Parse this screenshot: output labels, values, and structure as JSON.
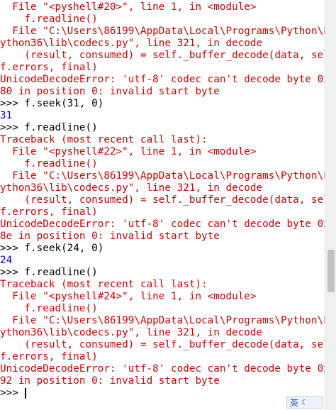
{
  "lines": [
    {
      "text": "  File \"<pyshell#20>\", line 1, in <module>",
      "kind": "err"
    },
    {
      "text": "    f.readline()",
      "kind": "err"
    },
    {
      "text": "  File \"C:\\Users\\86199\\AppData\\Local\\Programs\\Python\\P",
      "kind": "err"
    },
    {
      "text": "ython36\\lib\\codecs.py\", line 321, in decode",
      "kind": "err"
    },
    {
      "text": "    (result, consumed) = self._buffer_decode(data, sel",
      "kind": "err"
    },
    {
      "text": "f.errors, final)",
      "kind": "err"
    },
    {
      "text": "UnicodeDecodeError: 'utf-8' codec can't decode byte 0x",
      "kind": "err"
    },
    {
      "text": "80 in position 0: invalid start byte",
      "kind": "err"
    },
    {
      "text": ">>> f.seek(31, 0)",
      "kind": "in"
    },
    {
      "text": "31",
      "kind": "out"
    },
    {
      "text": ">>> f.readline()",
      "kind": "in"
    },
    {
      "text": "Traceback (most recent call last):",
      "kind": "err"
    },
    {
      "text": "  File \"<pyshell#22>\", line 1, in <module>",
      "kind": "err"
    },
    {
      "text": "    f.readline()",
      "kind": "err"
    },
    {
      "text": "  File \"C:\\Users\\86199\\AppData\\Local\\Programs\\Python\\P",
      "kind": "err"
    },
    {
      "text": "ython36\\lib\\codecs.py\", line 321, in decode",
      "kind": "err"
    },
    {
      "text": "    (result, consumed) = self._buffer_decode(data, sel",
      "kind": "err"
    },
    {
      "text": "f.errors, final)",
      "kind": "err"
    },
    {
      "text": "UnicodeDecodeError: 'utf-8' codec can't decode byte 0x",
      "kind": "err"
    },
    {
      "text": "8e in position 0: invalid start byte",
      "kind": "err"
    },
    {
      "text": ">>> f.seek(24, 0)",
      "kind": "in"
    },
    {
      "text": "24",
      "kind": "out"
    },
    {
      "text": ">>> f.readline()",
      "kind": "in"
    },
    {
      "text": "Traceback (most recent call last):",
      "kind": "err"
    },
    {
      "text": "  File \"<pyshell#24>\", line 1, in <module>",
      "kind": "err"
    },
    {
      "text": "    f.readline()",
      "kind": "err"
    },
    {
      "text": "  File \"C:\\Users\\86199\\AppData\\Local\\Programs\\Python\\P",
      "kind": "err"
    },
    {
      "text": "ython36\\lib\\codecs.py\", line 321, in decode",
      "kind": "err"
    },
    {
      "text": "    (result, consumed) = self._buffer_decode(data, sel",
      "kind": "err"
    },
    {
      "text": "f.errors, final)",
      "kind": "err"
    },
    {
      "text": "UnicodeDecodeError: 'utf-8' codec can't decode byte 0x",
      "kind": "err"
    },
    {
      "text": "92 in position 0: invalid start byte",
      "kind": "err"
    },
    {
      "text": ">>> ",
      "kind": "in"
    }
  ],
  "ime": {
    "label": "英",
    "icon": "moon-icon"
  },
  "colors": {
    "error": "#d00000",
    "output": "#0000cc",
    "input": "#000000"
  }
}
